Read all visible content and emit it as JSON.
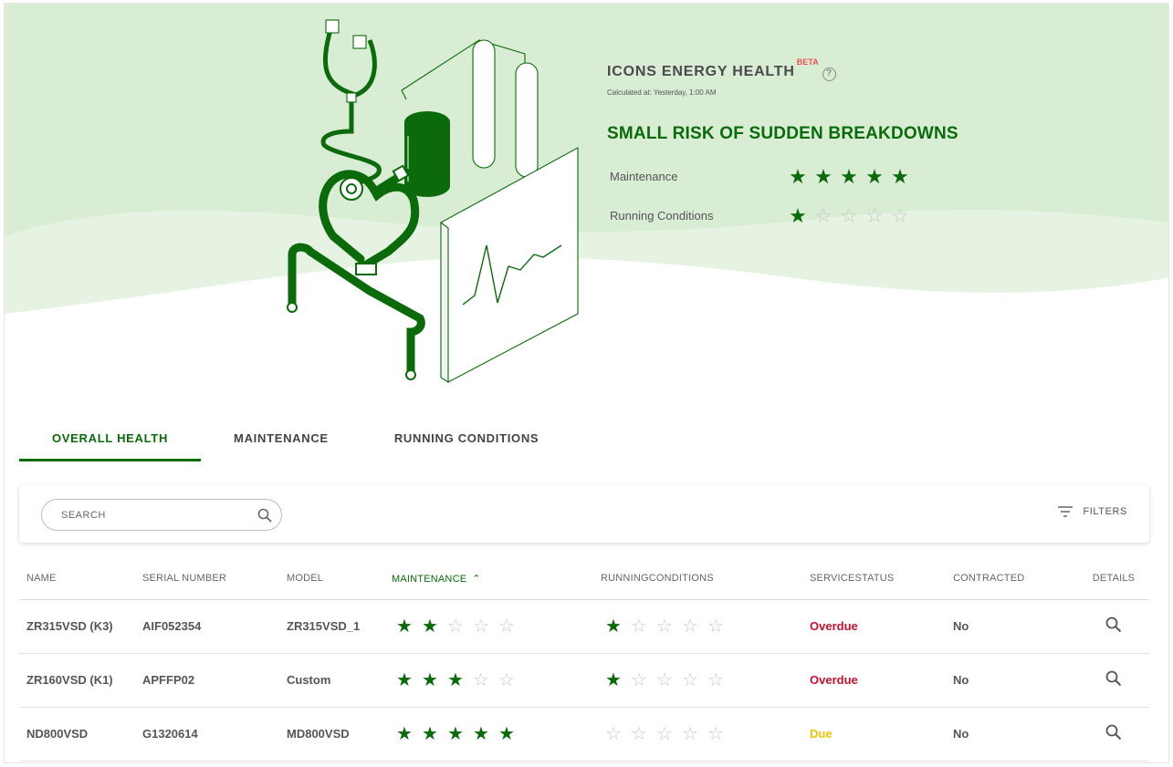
{
  "health": {
    "title": "ICONS ENERGY HEALTH",
    "beta": "BETA",
    "calculated": "Calculated at: Yesterday, 1:00 AM",
    "risk": "SMALL RISK OF SUDDEN BREAKDOWNS",
    "scores": [
      {
        "label": "Maintenance",
        "rating": 5
      },
      {
        "label": "Running Conditions",
        "rating": 1
      }
    ]
  },
  "tabs": [
    "OVERALL HEALTH",
    "MAINTENANCE",
    "RUNNING CONDITIONS"
  ],
  "search": {
    "placeholder": "SEARCH"
  },
  "filters_label": "FILTERS",
  "table": {
    "columns": [
      "NAME",
      "SERIAL NUMBER",
      "MODEL",
      "MAINTENANCE",
      "RUNNINGCONDITIONS",
      "SERVICESTATUS",
      "CONTRACTED",
      "DETAILS"
    ],
    "rows": [
      {
        "name": "ZR315VSD (K3)",
        "serial": "AIF052354",
        "model": "ZR315VSD_1",
        "maintenance": 2,
        "running": 1,
        "status": "Overdue",
        "contracted": "No"
      },
      {
        "name": "ZR160VSD (K1)",
        "serial": "APFFP02",
        "model": "Custom",
        "maintenance": 3,
        "running": 1,
        "status": "Overdue",
        "contracted": "No"
      },
      {
        "name": "ND800VSD",
        "serial": "G1320614",
        "model": "MD800VSD",
        "maintenance": 5,
        "running": 0,
        "status": "Due",
        "contracted": "No"
      }
    ]
  },
  "colors": {
    "accent": "#0b6b0b",
    "overdue": "#c8102e",
    "due": "#f2c200",
    "hero_bg": "#d8edd4"
  }
}
